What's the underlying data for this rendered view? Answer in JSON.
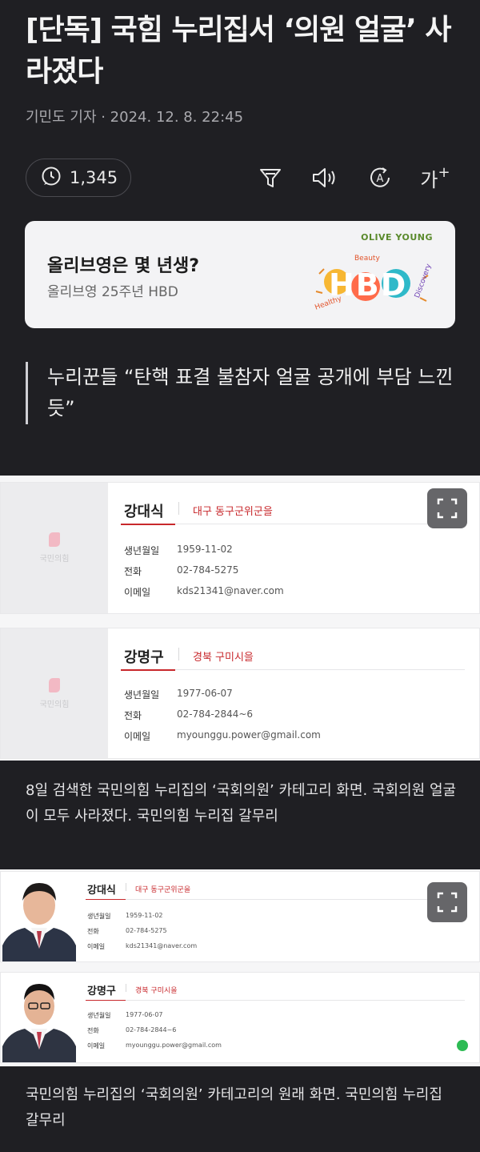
{
  "article": {
    "title": "[단독] 국힘 누리집서 ‘의원 얼굴’ 사라졌다",
    "byline": "기민도 기자 · 2024. 12. 8. 22:45",
    "comment_count": "1,345",
    "quote": "누리꾼들 “탄핵 표결 불참자 얼굴 공개에 부담 느낀 듯”",
    "caption1": "8일 검색한 국민의힘 누리집의 ‘국회의원’ 카테고리 화면. 국회의원 얼굴이 모두 사라졌다. 국민의힘 누리집 갈무리",
    "caption2": "국민의힘 누리집의 ‘국회의원’ 카테고리의 원래 화면. 국민의힘 누리집 갈무리"
  },
  "toolbar": {
    "font_size_label": "가"
  },
  "ad": {
    "title": "올리브영은 몇 년생?",
    "subtitle": "올리브영 25주년 HBD",
    "brand": "OLIVE YOUNG",
    "art_text": "HBD",
    "art_words": [
      "Beauty",
      "Discovery",
      "Healthy"
    ]
  },
  "members": [
    {
      "name": "강대식",
      "district": "대구 동구군위군을",
      "birth_label": "생년월일",
      "birth": "1959-11-02",
      "phone_label": "전화",
      "phone": "02-784-5275",
      "email_label": "이메일",
      "email": "kds21341@naver.com"
    },
    {
      "name": "강명구",
      "district": "경북 구미시을",
      "birth_label": "생년월일",
      "birth": "1977-06-07",
      "phone_label": "전화",
      "phone": "02-784-2844~6",
      "email_label": "이메일",
      "email": "myounggu.power@gmail.com"
    }
  ],
  "placeholder_text": "국민의힘",
  "colors": {
    "background": "#1f1f23",
    "party_red": "#c8282c",
    "ad_green": "#5a8a2c"
  },
  "icons": [
    "comment-icon",
    "filter-icon",
    "speaker-icon",
    "translate-icon",
    "font-size-icon",
    "expand-icon"
  ]
}
